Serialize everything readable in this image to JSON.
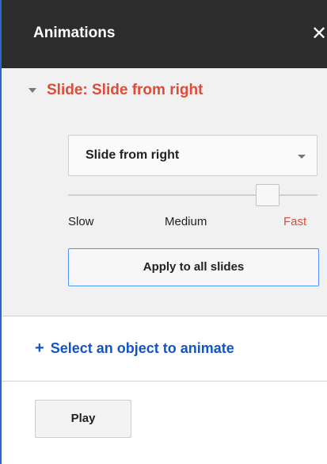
{
  "header": {
    "title": "Animations",
    "close_label": "✕",
    "close_icon": "close-icon"
  },
  "animation_section": {
    "title": "Slide: Slide from right",
    "expanded": true,
    "toggle_icon": "triangle-down-icon",
    "effect_select": {
      "value": "Slide from right",
      "arrow_icon": "dropdown-arrow-icon"
    },
    "speed": {
      "labels": {
        "slow": "Slow",
        "medium": "Medium",
        "fast": "Fast"
      },
      "selected": "Fast",
      "value": 0.8
    },
    "apply_button_label": "Apply to all slides"
  },
  "select_object": {
    "icon_glyph": "+",
    "icon": "plus-icon",
    "label": "Select an object to animate"
  },
  "play_button_label": "Play",
  "colors": {
    "header_bg": "#2d2d2d",
    "accent_red": "#dd4b39",
    "link_blue": "#1155cc",
    "focus_blue": "#4d90fe",
    "panel_border": "#2a67c9"
  }
}
